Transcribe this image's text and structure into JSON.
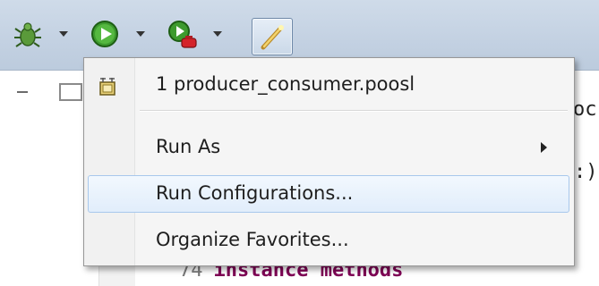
{
  "toolbar": {
    "buttons": [
      {
        "name": "debug-button",
        "icon": "bug-icon"
      },
      {
        "name": "run-button",
        "icon": "play-icon"
      },
      {
        "name": "external-tools-button",
        "icon": "external-tools-icon"
      },
      {
        "name": "quick-access-button",
        "icon": "wand-icon"
      }
    ]
  },
  "menu": {
    "items": [
      {
        "label": "1 producer_consumer.poosl",
        "icon": "poosl-file-icon"
      },
      {
        "label": "Run As",
        "has_submenu": true
      },
      {
        "label": "Run Configurations...",
        "highlighted": true
      },
      {
        "label": "Organize Favorites..."
      }
    ]
  },
  "editor": {
    "peek_top": "oc",
    "peek_mid": ":)",
    "code_line_number": "74",
    "code_text": "instance methods"
  },
  "colors": {
    "toolbar_bg": "#c3d1e2",
    "menu_bg": "#f5f5f5",
    "highlight_border": "#a8c8ec",
    "keyword": "#7f0055"
  }
}
